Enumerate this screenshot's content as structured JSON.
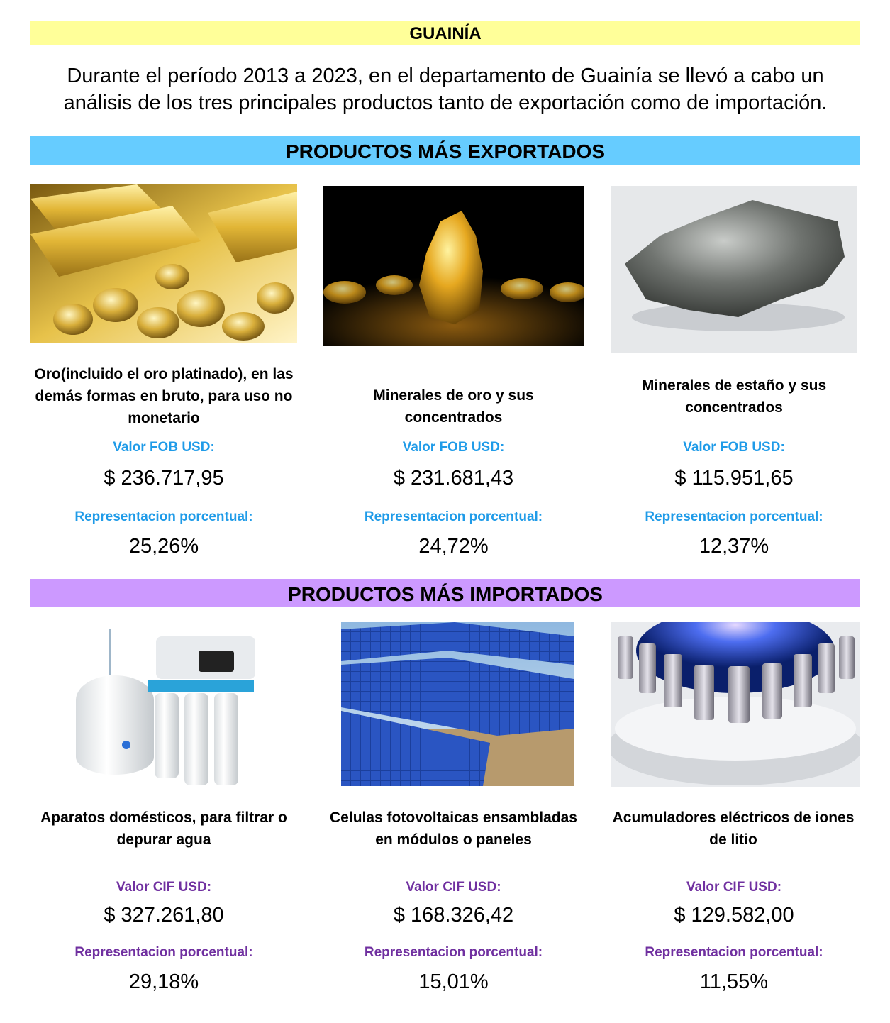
{
  "header": {
    "title": "GUAINÍA",
    "intro": "Durante el período 2013 a 2023, en el departamento de Guainía se llevó a cabo un análisis de los tres principales productos tanto de exportación como de importación."
  },
  "exports": {
    "section_title": "PRODUCTOS MÁS EXPORTADOS",
    "value_label": "Valor FOB USD:",
    "share_label": "Representacion porcentual:",
    "label_color": "#1f9be8",
    "band_color": "#66ccff",
    "items": [
      {
        "name": "Oro(incluido el oro platinado), en las demás formas en bruto, para uso no monetario",
        "value": "$ 236.717,95",
        "share": "25,26%",
        "image": "gold-bars-and-nuggets"
      },
      {
        "name": "Minerales de oro y sus concentrados",
        "value": "$ 231.681,43",
        "share": "24,72%",
        "image": "gold-nugget"
      },
      {
        "name": "Minerales de estaño y sus concentrados",
        "value": "$ 115.951,65",
        "share": "12,37%",
        "image": "tin-ore-rock"
      }
    ]
  },
  "imports": {
    "section_title": "PRODUCTOS MÁS IMPORTADOS",
    "value_label": "Valor CIF USD:",
    "share_label": "Representacion porcentual:",
    "label_color": "#7030a0",
    "band_color": "#cc99ff",
    "items": [
      {
        "name": "Aparatos domésticos, para filtrar o depurar agua",
        "value": "$ 327.261,80",
        "share": "29,18%",
        "image": "water-filter-system"
      },
      {
        "name": "Celulas fotovoltaicas ensambladas en módulos o paneles",
        "value": "$ 168.326,42",
        "share": "15,01%",
        "image": "solar-panels"
      },
      {
        "name": "Acumuladores eléctricos de iones de litio",
        "value": "$ 129.582,00",
        "share": "11,55%",
        "image": "lithium-ion-cells"
      }
    ]
  }
}
